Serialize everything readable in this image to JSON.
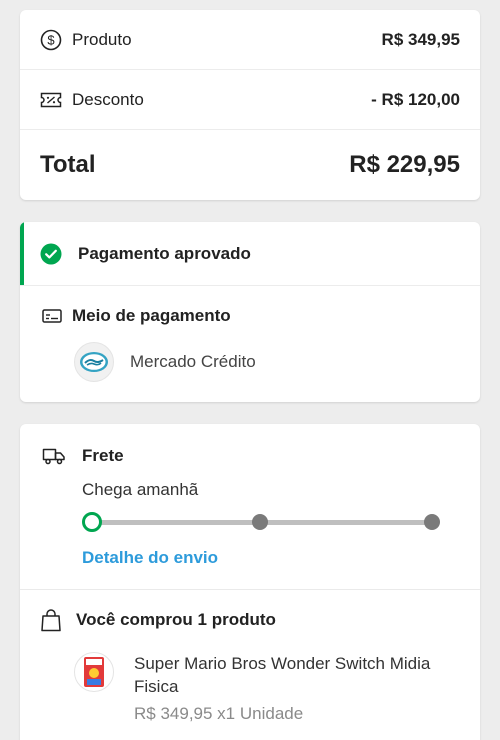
{
  "summary": {
    "product_label": "Produto",
    "product_value": "R$ 349,95",
    "discount_label": "Desconto",
    "discount_value": "- R$ 120,00",
    "total_label": "Total",
    "total_value": "R$ 229,95"
  },
  "payment": {
    "status": "Pagamento aprovado",
    "method_title": "Meio de pagamento",
    "method_name": "Mercado Crédito"
  },
  "shipping": {
    "title": "Frete",
    "eta": "Chega amanhã",
    "detail_link": "Detalhe do envio",
    "progress_step": 1,
    "progress_total_steps": 3
  },
  "products": {
    "title": "Você comprou 1 produto",
    "items": [
      {
        "name": "Super Mario Bros Wonder Switch Midia Fisica",
        "meta": "R$ 349,95 x1 Unidade"
      }
    ]
  },
  "colors": {
    "success": "#00a650",
    "link": "#2d9bdb",
    "background": "#ededed"
  },
  "icons": {
    "product": "dollar-circle-icon",
    "discount": "coupon-icon",
    "status": "check-circle-icon",
    "method": "card-icon",
    "shipping": "truck-icon",
    "products": "bag-icon"
  }
}
